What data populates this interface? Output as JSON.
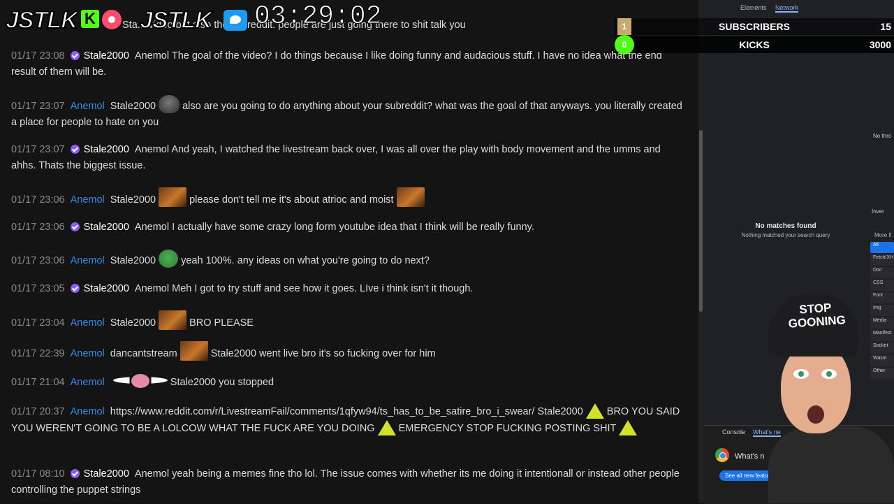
{
  "overlay": {
    "logo1": "JSTLK",
    "logo2": "JSTLK",
    "timer": "03:29:02",
    "subscribers": {
      "count": "1",
      "label": "SUBSCRIBERS",
      "goal": "15"
    },
    "kicks": {
      "count": "0",
      "label": "KICKS",
      "goal": "3000"
    },
    "hat_text": "STOP GOONING"
  },
  "chat": {
    "top_partial": "Sta... video but also the subreddit. people are just going there to shit talk you",
    "messages": [
      {
        "ts": "01/17 23:08",
        "user": "Stale2000",
        "text": "Anemol The goal of the video? I do things because I like doing funny and audacious stuff. I have no idea what the end result of them will be."
      },
      {
        "ts": "01/17 23:07",
        "user": "Anemol",
        "text": "Stale2000",
        "text2": "also are you going to do anything about your subreddit? what was the goal of that anyways. you literally created a place for people to hate on you"
      },
      {
        "ts": "01/17 23:07",
        "user": "Stale2000",
        "text": "Anemol And yeah, I watched the livestream back over, I was all over the play with body movement and the umms and ahhs. Thats the biggest issue."
      },
      {
        "ts": "01/17 23:06",
        "user": "Anemol",
        "text": "Stale2000",
        "text2": "please don't tell me it's about atrioc and moist"
      },
      {
        "ts": "01/17 23:06",
        "user": "Stale2000",
        "text": "Anemol I actually have some crazy long form youtube idea that I think will be really funny."
      },
      {
        "ts": "01/17 23:06",
        "user": "Anemol",
        "text": "Stale2000",
        "text2": "yeah 100%. any ideas on what you're going to do next?"
      },
      {
        "ts": "01/17 23:05",
        "user": "Stale2000",
        "text": "Anemol Meh I got to try stuff and see how it goes. LIve i think isn't it though."
      },
      {
        "ts": "01/17 23:04",
        "user": "Anemol",
        "text": "Stale2000",
        "text2": "BRO PLEASE"
      },
      {
        "ts": "01/17 22:39",
        "user": "Anemol",
        "text": "dancantstream",
        "text2": "Stale2000 went live bro it's so fucking over for him"
      },
      {
        "ts": "01/17 21:04",
        "user": "Anemol",
        "text": "",
        "text2": "Stale2000 you stopped"
      },
      {
        "ts": "01/17 20:37",
        "user": "Anemol",
        "text": "https://www.reddit.com/r/LivestreamFail/comments/1qfyw94/ts_has_to_be_satire_bro_i_swear/ Stale2000",
        "text2": "BRO YOU SAID YOU WEREN'T GOING TO BE A LOLCOW WHAT THE FUCK ARE YOU DOING",
        "text3": "EMERGENCY STOP FUCKING POSTING SHIT"
      },
      {
        "ts": "01/17 08:10",
        "user": "Stale2000",
        "text": "Anemol yeah being a memes fine tho lol. The issue comes with whether its me doing it intentionall or instead other people controlling the puppet strings"
      }
    ]
  },
  "devtools": {
    "tabs": [
      "Elements",
      "Network"
    ],
    "no_matches_title": "No matches found",
    "no_matches_sub": "Nothing matched your search query",
    "no_throttle": "No thro",
    "invert": "Inver",
    "more": "More fi",
    "filters": [
      "All",
      "Fetch/XH",
      "Doc",
      "CSS",
      "Font",
      "Img",
      "Media",
      "Manifest",
      "Socket",
      "Wasm",
      "Other"
    ],
    "drawer_tabs": [
      "Console",
      "What's ne"
    ],
    "whats_new": "What's n",
    "see_all": "See all new featu"
  },
  "colors": {
    "anemol": "#2f8be6",
    "stale": "#ffffff",
    "accent": "#8ab4f8",
    "kick": "#53fc18"
  }
}
